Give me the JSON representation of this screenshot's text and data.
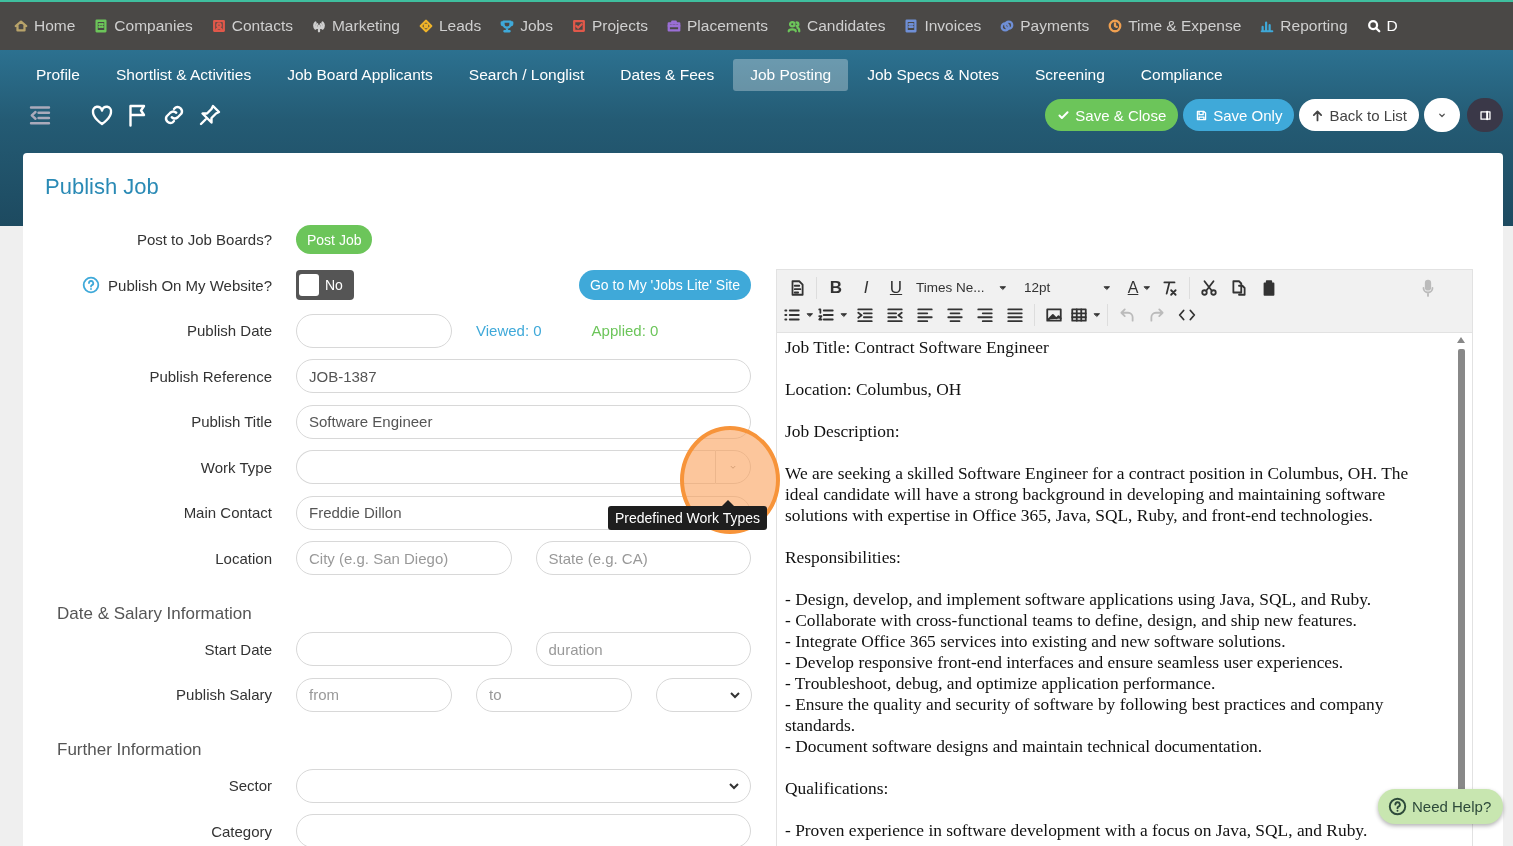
{
  "main_nav": [
    {
      "label": "Home",
      "color": "#b8a36a"
    },
    {
      "label": "Companies",
      "color": "#6cc55a"
    },
    {
      "label": "Contacts",
      "color": "#e0584a"
    },
    {
      "label": "Marketing",
      "color": "#cfcfcf"
    },
    {
      "label": "Leads",
      "color": "#f0b429"
    },
    {
      "label": "Jobs",
      "color": "#3fa9d9"
    },
    {
      "label": "Projects",
      "color": "#e0584a"
    },
    {
      "label": "Placements",
      "color": "#9b6fd6"
    },
    {
      "label": "Candidates",
      "color": "#6cc55a"
    },
    {
      "label": "Invoices",
      "color": "#6f8fd6"
    },
    {
      "label": "Payments",
      "color": "#6f8fd6"
    },
    {
      "label": "Time & Expense",
      "color": "#f0a050"
    },
    {
      "label": "Reporting",
      "color": "#3fa9d9"
    },
    {
      "label": "D",
      "color": "#ffffff"
    }
  ],
  "sub_tabs": [
    {
      "label": "Profile",
      "selected": false
    },
    {
      "label": "Shortlist & Activities",
      "selected": false
    },
    {
      "label": "Job Board Applicants",
      "selected": false
    },
    {
      "label": "Search / Longlist",
      "selected": false
    },
    {
      "label": "Dates & Fees",
      "selected": false
    },
    {
      "label": "Job Posting",
      "selected": true
    },
    {
      "label": "Job Specs & Notes",
      "selected": false
    },
    {
      "label": "Screening",
      "selected": false
    },
    {
      "label": "Compliance",
      "selected": false
    }
  ],
  "actions": [
    {
      "label": "Save & Close",
      "kind": "save-close"
    },
    {
      "label": "Save Only",
      "kind": "save"
    },
    {
      "label": "Back to List",
      "kind": "back"
    }
  ],
  "page_title": "Publish Job",
  "form": [
    {
      "kind": "button",
      "label": "Post to Job Boards?",
      "button": "Post Job"
    },
    {
      "kind": "toggle",
      "label": "Publish On My Website?",
      "on": false,
      "state_text": "No",
      "link": "Go to My 'Jobs Lite' Site"
    },
    {
      "kind": "stats",
      "label": "Publish Date",
      "viewed": "Viewed: 0",
      "applied": "Applied: 0"
    },
    {
      "kind": "text",
      "label": "Publish Reference",
      "value": "JOB-1387"
    },
    {
      "kind": "text",
      "label": "Publish Title",
      "value": "Software Engineer"
    },
    {
      "kind": "combo",
      "label": "Work Type"
    },
    {
      "kind": "text",
      "label": "Main Contact",
      "value": "Freddie Dillon"
    },
    {
      "kind": "pair",
      "label": "Location",
      "fields": [
        {
          "placeholder": "City (e.g. San Diego)"
        },
        {
          "placeholder": "State (e.g. CA)"
        }
      ]
    },
    {
      "kind": "section",
      "label": "Date & Salary Information"
    },
    {
      "kind": "pair",
      "label": "Start Date",
      "fields": [
        {
          "placeholder": "duration"
        }
      ]
    },
    {
      "kind": "salary",
      "label": "Publish Salary",
      "fields": [
        {
          "placeholder": "from"
        },
        {
          "placeholder": "to"
        }
      ]
    },
    {
      "kind": "section",
      "label": "Further Information"
    },
    {
      "kind": "select",
      "label": "Sector"
    },
    {
      "kind": "text",
      "label": "Category"
    }
  ],
  "editor": {
    "bold": "B",
    "italic": "I",
    "underline": "U",
    "font": "Times Ne...",
    "size": "12pt",
    "color_letter": "A",
    "paragraphs": [
      [
        "Job Title: Contract Software Engineer"
      ],
      [
        "Location: Columbus, OH"
      ],
      [
        "Job Description:"
      ],
      [
        "We are seeking a skilled Software Engineer for a contract position in Columbus, OH. The ideal candidate will have a strong background in developing and maintaining software solutions with expertise in Office 365, Java, SQL, Ruby, and front-end technologies."
      ],
      [
        "Responsibilities:"
      ],
      [
        "- Design, develop, and implement software applications using Java, SQL, and Ruby.",
        "- Collaborate with cross-functional teams to define, design, and ship new features.",
        "- Integrate Office 365 services into existing and new software solutions.",
        "- Develop responsive front-end interfaces and ensure seamless user experiences.",
        "- Troubleshoot, debug, and optimize application performance.",
        "- Ensure the quality and security of software by following best practices and company standards.",
        "- Document software designs and maintain technical documentation."
      ],
      [
        "Qualifications:"
      ],
      [
        "- Proven experience in software development with a focus on Java, SQL, and Ruby."
      ]
    ]
  },
  "tooltip": "Predefined Work Types",
  "help_button": "Need Help?"
}
